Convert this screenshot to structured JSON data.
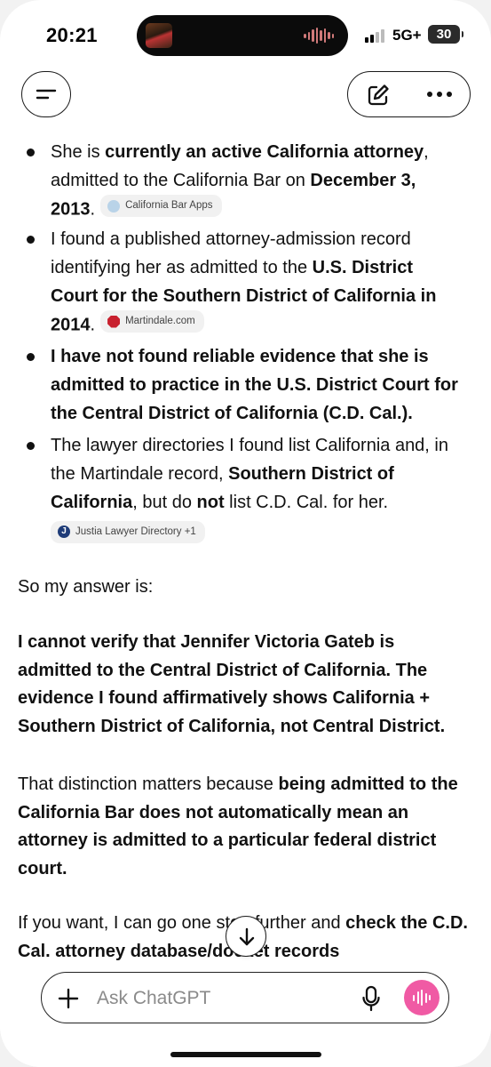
{
  "status_bar": {
    "time": "20:21",
    "network": "5G+",
    "battery": "30"
  },
  "nav": {
    "menu_icon": "menu-icon",
    "edit_icon": "new-chat-icon",
    "more_icon": "more-icon"
  },
  "message": {
    "bullets": [
      {
        "parts": [
          {
            "t": "She is ",
            "b": false
          },
          {
            "t": "currently an active California attorney",
            "b": true
          },
          {
            "t": ", admitted to the California Bar on ",
            "b": false
          },
          {
            "t": "December 3, 2013",
            "b": true
          },
          {
            "t": ".",
            "b": false
          }
        ],
        "chip": {
          "label": "California Bar Apps",
          "icon_color": "#b9d3e8"
        }
      },
      {
        "parts": [
          {
            "t": "I found a published attorney-admission record identifying her as admitted to the ",
            "b": false
          },
          {
            "t": "U.S. District Court for the Southern District of California in 2014",
            "b": true
          },
          {
            "t": ".",
            "b": false
          }
        ],
        "chip": {
          "label": "Martindale.com",
          "icon_color": "#c8202e"
        }
      },
      {
        "parts": [
          {
            "t": "I have not found reliable evidence that she is admitted to practice in the U.S. District Court for the Central District of California (C.D. Cal.).",
            "b": true
          }
        ]
      },
      {
        "parts": [
          {
            "t": "The lawyer directories I found list California and, in the Martindale record, ",
            "b": false
          },
          {
            "t": "Southern District of California",
            "b": true
          },
          {
            "t": ", but do ",
            "b": false
          },
          {
            "t": "not",
            "b": true
          },
          {
            "t": " list C.D. Cal. for her.",
            "b": false
          }
        ],
        "chip": {
          "label": "Justia Lawyer Directory +1",
          "icon_color": "#1f3c78",
          "icon_letter": "J"
        }
      }
    ],
    "answer_intro": "So my answer is:",
    "answer_bold": "I cannot verify that Jennifer Victoria Gateb is admitted to the Central District of California. The evidence I found affirmatively shows California + Southern District of California, not Central District.",
    "distinction": [
      {
        "t": "That distinction matters because ",
        "b": false
      },
      {
        "t": "being admitted to the California Bar does not automatically mean an attorney is admitted to a particular federal district court.",
        "b": true
      }
    ],
    "offer": [
      {
        "t": "If you want, I can go one step further and ",
        "b": false
      },
      {
        "t": "check the C.D. Cal. attorney database/docket records",
        "b": true
      }
    ]
  },
  "composer": {
    "placeholder": "Ask ChatGPT",
    "plus_icon": "plus-icon",
    "mic_icon": "microphone-icon",
    "voice_icon": "voice-mode-icon"
  },
  "scroll": {
    "icon": "arrow-down-icon"
  }
}
